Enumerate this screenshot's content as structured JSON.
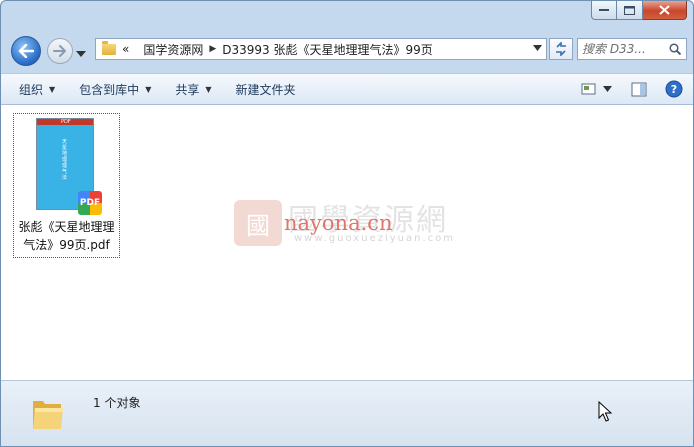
{
  "address": {
    "overflow": "«",
    "crumbs": [
      "国学资源网",
      "D33993 张彪《天星地理理气法》99页"
    ]
  },
  "search": {
    "placeholder": "搜索 D33..."
  },
  "toolbar": {
    "organize": "组织",
    "include_in_library": "包含到库中",
    "share": "共享",
    "new_folder": "新建文件夹"
  },
  "files": [
    {
      "name": "张彪《天星地理理气法》99页.pdf",
      "badge": "PDF",
      "thumb_header": "PDF",
      "thumb_title": "天星地理理气法"
    }
  ],
  "watermark": {
    "chinese": "國學資源網",
    "site": "nayona.cn",
    "url": "www.guoxueziyuan.com"
  },
  "status": {
    "count_text": "1 个对象"
  },
  "colors": {
    "accent": "#2a6fc9",
    "close": "#c9462c",
    "thumb": "#39b3e6"
  }
}
